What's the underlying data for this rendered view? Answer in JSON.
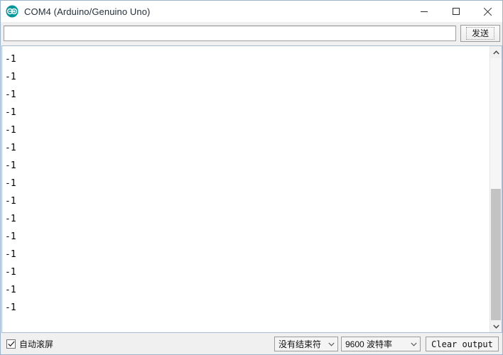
{
  "window": {
    "title": "COM4 (Arduino/Genuino Uno)",
    "icon": "arduino-logo-icon",
    "controls": {
      "minimize": "minimize-icon",
      "maximize": "maximize-icon",
      "close": "close-icon"
    }
  },
  "send_row": {
    "input_value": "",
    "input_placeholder": "",
    "send_label": "发送"
  },
  "output": {
    "lines": [
      "-1",
      "-1",
      "-1",
      "-1",
      "-1",
      "-1",
      "-1",
      "-1",
      "-1",
      "-1",
      "-1",
      "-1",
      "-1",
      "-1",
      "-1"
    ]
  },
  "scrollbar": {
    "up_icon": "chevron-up-icon",
    "down_icon": "chevron-down-icon"
  },
  "bottom": {
    "autoscroll_label": "自动滚屏",
    "autoscroll_checked": true,
    "line_ending_value": "没有结束符",
    "baud_value": "9600 波特率",
    "clear_output_label": "Clear output"
  },
  "colors": {
    "accent": "#00979c",
    "window_border": "#9fb4cc",
    "text_area_border": "#a8bcd2",
    "chrome": "#f0f0f0"
  }
}
